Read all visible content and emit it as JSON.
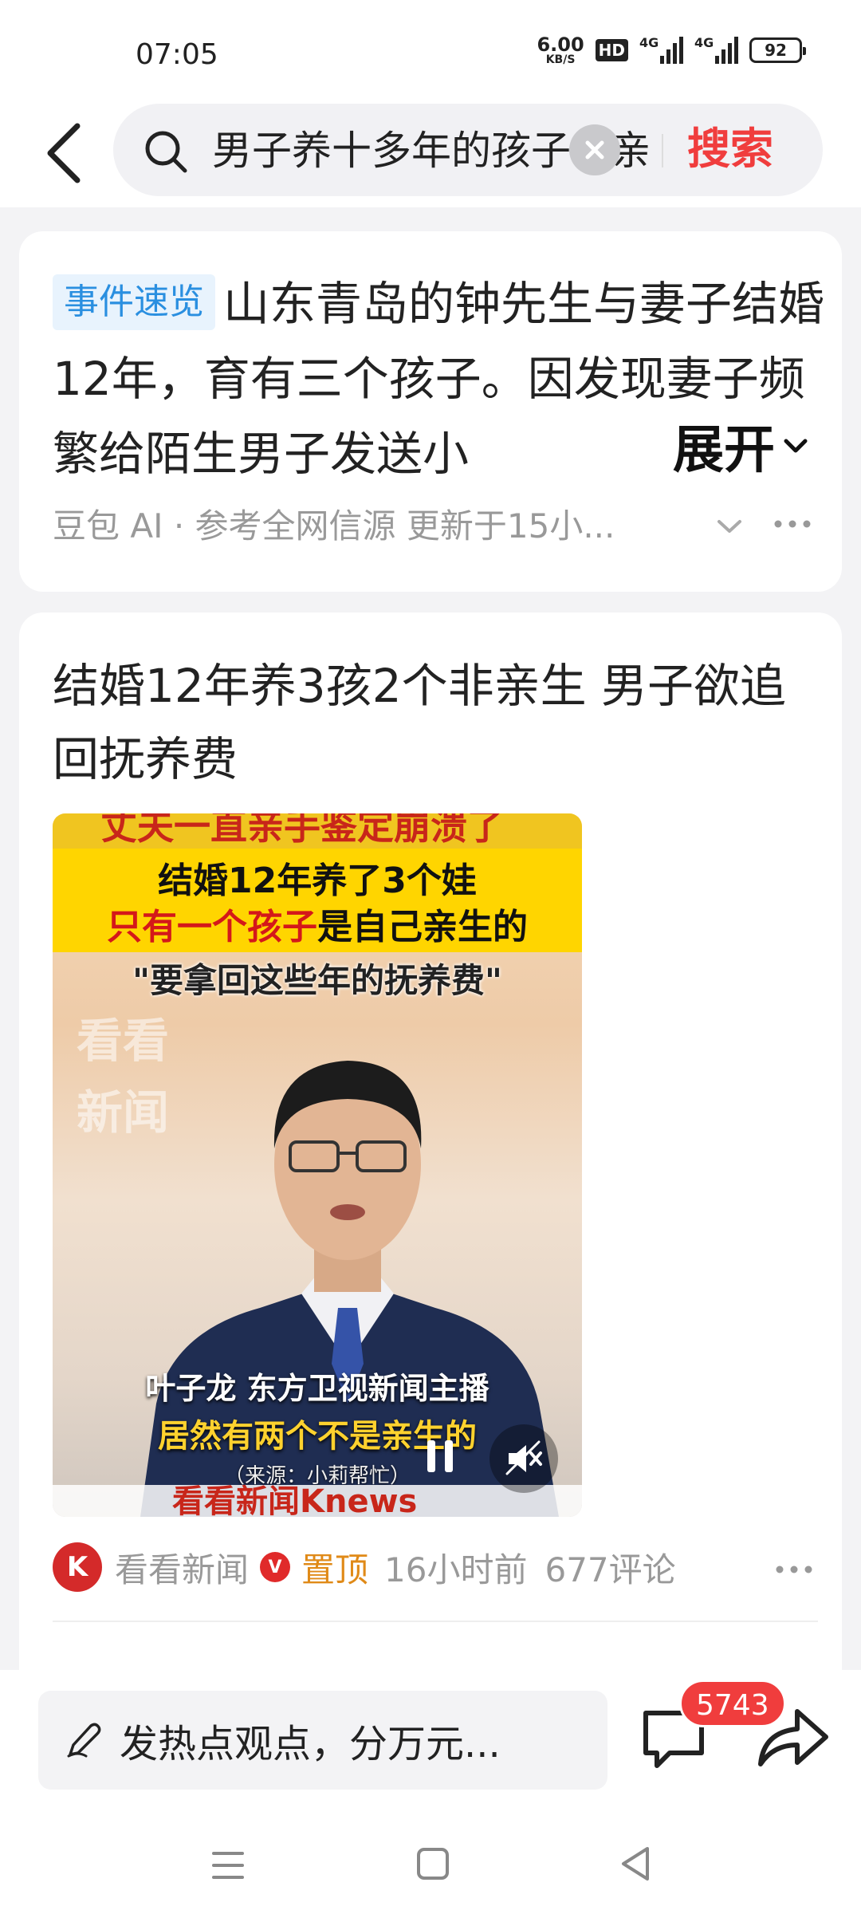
{
  "status_bar": {
    "time": "07:05",
    "net_speed_value": "6.00",
    "net_speed_unit": "KB/S",
    "hd_badge": "HD",
    "signal1_label": "4G",
    "signal2_label": "4G",
    "battery": "92"
  },
  "search": {
    "query": "男子养十多年的孩子非亲生",
    "submit_label": "搜索"
  },
  "event_card": {
    "tag": "事件速览",
    "text": "山东青岛的钟先生与妻子结婚12年，育有三个孩子。因发现妻子频繁给陌生男子发送小",
    "expand_label": "展开",
    "meta": "豆包 AI · 参考全网信源 更新于15小..."
  },
  "article": {
    "title": "结婚12年养3孩2个非亲生 男子欲追回抚养费",
    "video": {
      "banner_top": "丈夫一直亲手鉴定崩溃了",
      "line1": "结婚12年养了3个娃",
      "line2_red": "只有一个孩子",
      "line2_rest": "是自己亲生的",
      "line3": "\"要拿回这些年的抚养费\"",
      "watermark": "看看新闻",
      "caption_name": "叶子龙  东方卫视新闻主播",
      "caption_quote": "居然有两个不是亲生的",
      "caption_source": "（来源：小莉帮忙）",
      "brand": "看看新闻Knews"
    },
    "source_logo": "K",
    "source": "看看新闻",
    "verified_mark": "V",
    "pinned": "置顶",
    "time": "16小时前",
    "comments": "677评论"
  },
  "bottom_bar": {
    "comment_placeholder": "发热点观点，分万元...",
    "comment_count": "5743"
  }
}
